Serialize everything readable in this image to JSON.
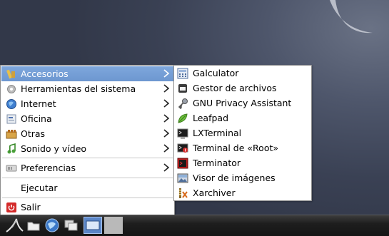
{
  "main_menu": {
    "items": [
      {
        "label": "Accesorios",
        "icon": "accessories-icon",
        "submenu": true,
        "selected": true
      },
      {
        "label": "Herramientas del sistema",
        "icon": "system-tools-icon",
        "submenu": true
      },
      {
        "label": "Internet",
        "icon": "internet-globe-icon",
        "submenu": true
      },
      {
        "label": "Oficina",
        "icon": "office-icon",
        "submenu": true
      },
      {
        "label": "Otras",
        "icon": "other-apps-icon",
        "submenu": true
      },
      {
        "label": "Sonido y vídeo",
        "icon": "multimedia-icon",
        "submenu": true
      },
      {
        "label": "Preferencias",
        "icon": "preferences-icon",
        "submenu": true
      },
      {
        "label": "Ejecutar",
        "icon": "",
        "submenu": false
      },
      {
        "label": "Salir",
        "icon": "logout-icon",
        "submenu": false
      }
    ]
  },
  "accessories_submenu": {
    "items": [
      {
        "label": "Galculator",
        "icon": "calculator-icon"
      },
      {
        "label": "Gestor de archivos",
        "icon": "file-manager-icon"
      },
      {
        "label": "GNU Privacy Assistant",
        "icon": "gpa-key-icon"
      },
      {
        "label": "Leafpad",
        "icon": "leafpad-icon"
      },
      {
        "label": "LXTerminal",
        "icon": "terminal-icon"
      },
      {
        "label": "Terminal de «Root»",
        "icon": "root-terminal-icon"
      },
      {
        "label": "Terminator",
        "icon": "terminator-icon"
      },
      {
        "label": "Visor de imágenes",
        "icon": "image-viewer-icon"
      },
      {
        "label": "Xarchiver",
        "icon": "archiver-icon"
      }
    ]
  },
  "taskbar": {
    "buttons": [
      "start-menu-icon",
      "file-manager-icon",
      "browser-globe-icon",
      "window-switcher-icon",
      "desktop-icon"
    ]
  },
  "colors": {
    "selection": "#7ea7dc",
    "desktop": "#3a4154",
    "taskbar": "#1e1e1e"
  }
}
